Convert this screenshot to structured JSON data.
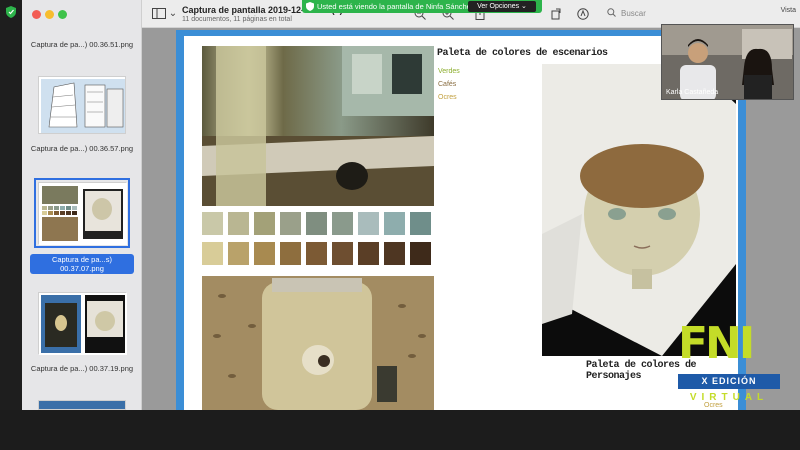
{
  "banner": {
    "text": "Usted está viendo la pantalla de Ninfa Sánchez",
    "button_label": "Ver Opciones"
  },
  "toolbar": {
    "title": "Captura de pantalla 2019-12-07 a la(s) 00.37.07",
    "subtitle": "11 documentos, 11 páginas en total",
    "search_placeholder": "Buscar",
    "view_label": "Vista"
  },
  "sidebar": {
    "items": [
      {
        "label": "Captura de pa...) 00.36.51.png",
        "selected": false
      },
      {
        "label": "Captura de pa...) 00.36.57.png",
        "selected": false
      },
      {
        "label": "Captura de pa...s) 00.37.07.png",
        "selected": true
      },
      {
        "label": "Captura de pa...) 00.37.19.png",
        "selected": false
      }
    ]
  },
  "page": {
    "palette_scenes_title": "Paleta de colores de escenarios",
    "palette_scenes_items": [
      "Verdes",
      "Cafés",
      "Ocres"
    ],
    "palette_characters_title": "Paleta de colores de Personajes",
    "palette_characters_sub": "Ocres",
    "swatches_row1": [
      "#c9c8a8",
      "#b9b692",
      "#a3a178",
      "#9aa08a",
      "#7f8e80",
      "#8a9a8c",
      "#a9bcbc",
      "#8eadad",
      "#6f8e8a"
    ],
    "swatches_row2": [
      "#d8cc98",
      "#b9a26a",
      "#a88a50",
      "#8e6e3e",
      "#7c5a34",
      "#6e4e30",
      "#5a3e26",
      "#4e3622",
      "#3e2a1a"
    ]
  },
  "participant": {
    "name": "Karla Castañeda"
  },
  "logo": {
    "letters": "FNI",
    "edition": "X EDICIÓN",
    "virtual": "VIRTUAL"
  }
}
